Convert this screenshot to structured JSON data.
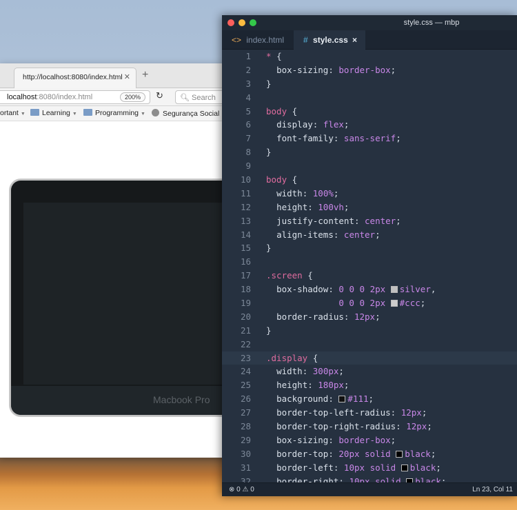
{
  "browser": {
    "tab_title": "http://localhost:8080/index.html",
    "url_host": "localhost",
    "url_path": ":8080/index.html",
    "zoom": "200%",
    "search_placeholder": "Search",
    "bookmarks": [
      "ortant",
      "Learning",
      "Programming",
      "Segurança Social ..."
    ],
    "page": {
      "device_label": "Macbook Pro"
    }
  },
  "editor": {
    "window_title": "style.css — mbp",
    "tabs": [
      {
        "label": "index.html",
        "icon": "<>"
      },
      {
        "label": "style.css",
        "icon": "#"
      }
    ],
    "close_glyph": "×",
    "status": {
      "errors": "0",
      "warnings": "0",
      "position": "Ln 23, Col 11"
    },
    "current_line": 23,
    "lines": [
      "* {",
      "  box-sizing: border-box;",
      "}",
      "",
      "body {",
      "  display: flex;",
      "  font-family: sans-serif;",
      "}",
      "",
      "body {",
      "  width: 100%;",
      "  height: 100vh;",
      "  justify-content: center;",
      "  align-items: center;",
      "}",
      "",
      ".screen {",
      "  box-shadow: 0 0 0 2px silver,",
      "              0 0 0 2px #ccc;",
      "  border-radius: 12px;",
      "}",
      "",
      ".display {",
      "  width: 300px;",
      "  height: 180px;",
      "  background: #111;",
      "  border-top-left-radius: 12px;",
      "  border-top-right-radius: 12px;",
      "  box-sizing: border-box;",
      "  border-top: 20px solid black;",
      "  border-left: 10px solid black;",
      "  border-right: 10px solid black;"
    ],
    "swatch_colors": {
      "silver": "#c0c0c0",
      "#ccc": "#cccccc",
      "#111": "#111111",
      "black": "#000000"
    }
  }
}
